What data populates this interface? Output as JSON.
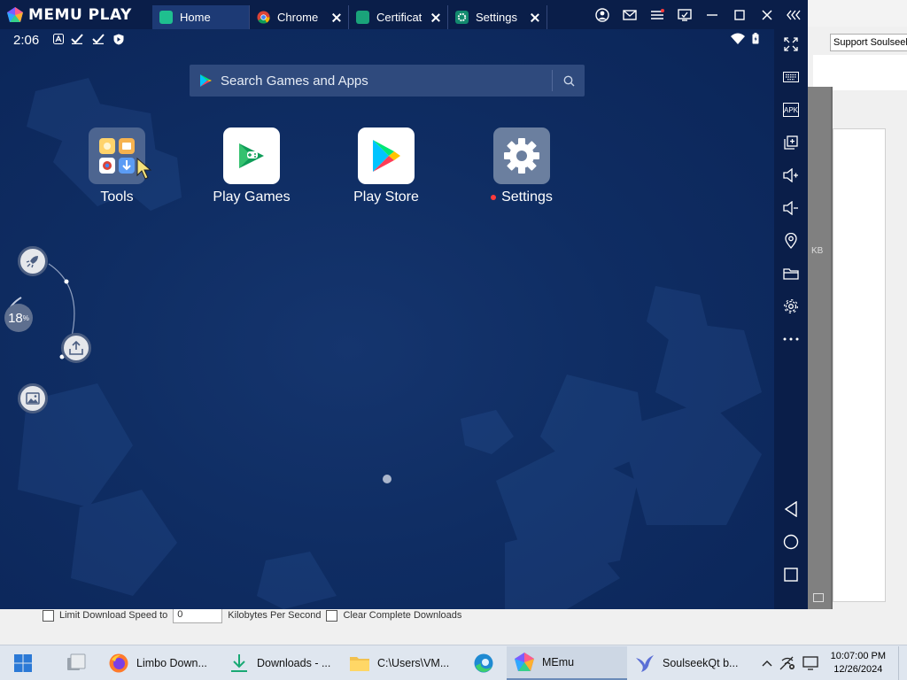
{
  "background_app": {
    "support_button": "Support Soulseek",
    "limit_download_label": "Limit Download Speed to",
    "speed_value": "0",
    "speed_unit": "Kilobytes Per Second",
    "clear_downloads_label": "Clear Complete Downloads",
    "side_fragment": "KB"
  },
  "memu": {
    "logo_text": "MEMU PLAY",
    "tabs": [
      {
        "label": "Home",
        "icon": "home-tab-icon",
        "color": "#1fbf8f"
      },
      {
        "label": "Chrome",
        "icon": "chrome-icon",
        "color": "#ffffff"
      },
      {
        "label": "Certificat",
        "icon": "android-icon",
        "color": "#1aa37a"
      },
      {
        "label": "Settings",
        "icon": "gear-icon",
        "color": "#138a6e"
      }
    ],
    "status": {
      "time": "2:06"
    },
    "search": {
      "placeholder": "Search Games and Apps"
    },
    "apps": [
      {
        "label": "Tools",
        "icon": "tools-folder-icon"
      },
      {
        "label": "Play Games",
        "icon": "play-games-icon"
      },
      {
        "label": "Play Store",
        "icon": "play-store-icon"
      },
      {
        "label": "Settings",
        "icon": "settings-gear-icon",
        "has_notification_dot": true
      }
    ],
    "float_menu": {
      "percent": "18",
      "percent_unit": "%"
    },
    "toolbar_items": [
      "fullscreen-icon",
      "keyboard-icon",
      "apk-icon",
      "multi-window-icon",
      "volume-up-icon",
      "volume-down-icon",
      "location-icon",
      "folder-icon",
      "settings-icon",
      "more-icon",
      "back-icon",
      "home-icon",
      "recents-icon"
    ],
    "apk_label": "APK"
  },
  "taskbar": {
    "items": [
      {
        "label": "",
        "icon": "windows-start-icon"
      },
      {
        "label": "",
        "icon": "task-view-icon"
      },
      {
        "label": "Limbo Down...",
        "icon": "firefox-icon"
      },
      {
        "label": "Downloads - ...",
        "icon": "download-arrow-icon"
      },
      {
        "label": "C:\\Users\\VM...",
        "icon": "file-explorer-icon"
      },
      {
        "label": "",
        "icon": "edge-icon"
      },
      {
        "label": "MEmu",
        "icon": "memu-icon"
      },
      {
        "label": "SoulseekQt b...",
        "icon": "soulseek-bird-icon"
      }
    ],
    "clock_time": "10:07:00 PM",
    "clock_date": "12/26/2024"
  },
  "colors": {
    "memu_title": "#0a1e49",
    "screen_bg": "#0f2d63",
    "search_bg": "#2f4a7d",
    "taskbar_bg": "#dfe6ef"
  }
}
